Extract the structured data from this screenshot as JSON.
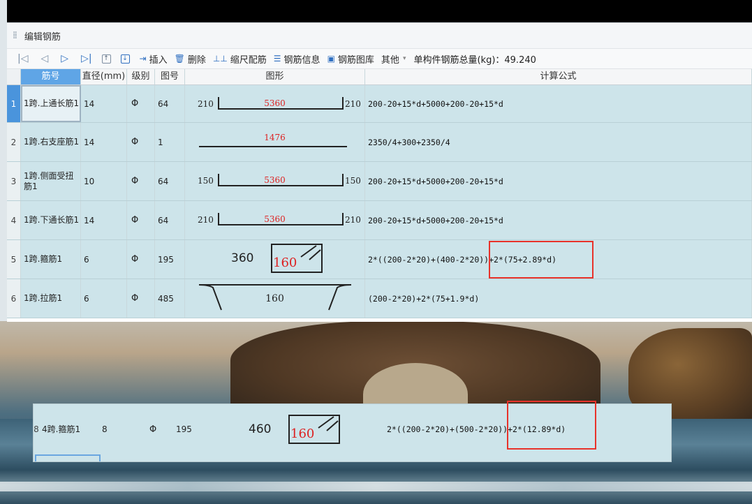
{
  "window": {
    "title": "编辑钢筋"
  },
  "toolbar": {
    "insert_label": "插入",
    "delete_label": "删除",
    "scale_label": "缩尺配筋",
    "info_label": "钢筋信息",
    "library_label": "钢筋图库",
    "other_label": "其他",
    "total_label": "单构件钢筋总量(kg)：49.240"
  },
  "columns": [
    "筋号",
    "直径(mm)",
    "级别",
    "图号",
    "图形",
    "计算公式"
  ],
  "rows": [
    {
      "idx": "1",
      "name": "1跨.上通长筋1",
      "dia": "14",
      "level": "Φ",
      "fig": "64",
      "shape": {
        "left": "210",
        "mid": "5360",
        "right": "210"
      },
      "formula": "200-20+15*d+5000+200-20+15*d"
    },
    {
      "idx": "2",
      "name": "1跨.右支座筋1",
      "dia": "14",
      "level": "Φ",
      "fig": "1",
      "shape": {
        "mid": "1476"
      },
      "formula": "2350/4+300+2350/4"
    },
    {
      "idx": "3",
      "name": "1跨.侧面受扭筋1",
      "dia": "10",
      "level": "Φ",
      "fig": "64",
      "shape": {
        "left": "150",
        "mid": "5360",
        "right": "150"
      },
      "formula": "200-20+15*d+5000+200-20+15*d"
    },
    {
      "idx": "4",
      "name": "1跨.下通长筋1",
      "dia": "14",
      "level": "Φ",
      "fig": "64",
      "shape": {
        "left": "210",
        "mid": "5360",
        "right": "210"
      },
      "formula": "200-20+15*d+5000+200-20+15*d"
    },
    {
      "idx": "5",
      "name": "1跨.箍筋1",
      "dia": "6",
      "level": "Φ",
      "fig": "195",
      "shape": {
        "left": "360",
        "mid": "160"
      },
      "formula": "2*((200-2*20)+(400-2*20))+2*(75+2.89*d)"
    },
    {
      "idx": "6",
      "name": "1跨.拉筋1",
      "dia": "6",
      "level": "Φ",
      "fig": "485",
      "shape": {
        "mid": "160"
      },
      "formula": "(200-2*20)+2*(75+1.9*d)"
    }
  ],
  "row8": {
    "idx": "8",
    "name": "4跨.箍筋1",
    "dia": "8",
    "level": "Φ",
    "fig": "195",
    "shape": {
      "left": "460",
      "mid": "160"
    },
    "formula": "2*((200-2*20)+(500-2*20))+2*(12.89*d)"
  }
}
